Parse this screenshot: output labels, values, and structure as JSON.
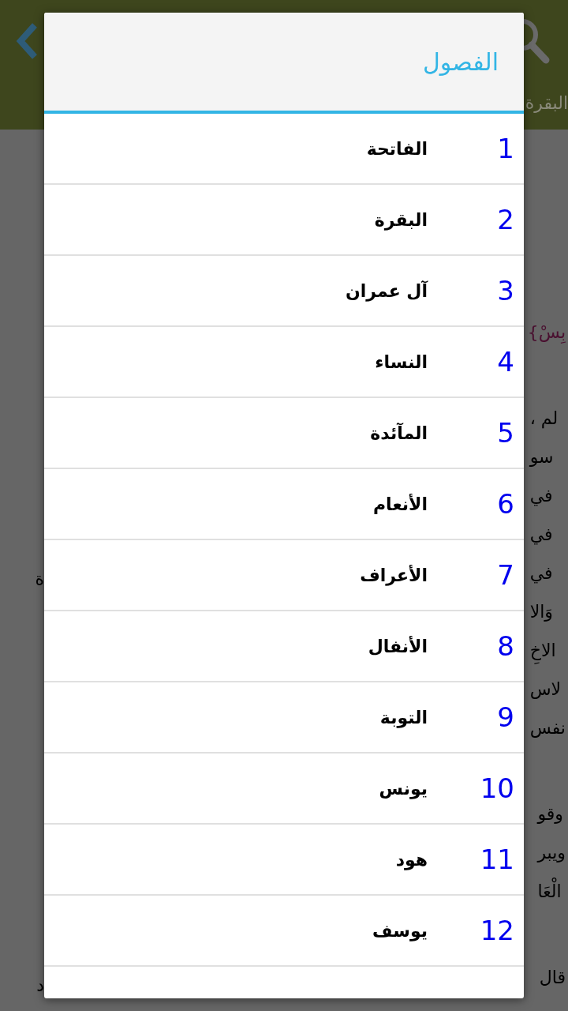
{
  "app_bar": {
    "subtitle": "البقرة"
  },
  "page_text": {
    "right_paragraphs": [
      [
        "{بِسْ"
      ],
      [
        "، لم",
        "سو",
        "في",
        "في",
        "في",
        "وَالا",
        "الاخِ",
        "لاس",
        "نفس"
      ],
      [
        "وقو",
        "ويبر",
        "الْعَا"
      ],
      [
        "قال"
      ]
    ],
    "left_fragments": [
      "ة",
      "د"
    ]
  },
  "dialog": {
    "title": "الفصول",
    "items": [
      {
        "number": "1",
        "name": "الفاتحة"
      },
      {
        "number": "2",
        "name": "البقرة"
      },
      {
        "number": "3",
        "name": "آل عمران"
      },
      {
        "number": "4",
        "name": "النساء"
      },
      {
        "number": "5",
        "name": "المآئدة"
      },
      {
        "number": "6",
        "name": "الأنعام"
      },
      {
        "number": "7",
        "name": "الأعراف"
      },
      {
        "number": "8",
        "name": "الأنفال"
      },
      {
        "number": "9",
        "name": "التوبة"
      },
      {
        "number": "10",
        "name": "يونس"
      },
      {
        "number": "11",
        "name": "هود"
      },
      {
        "number": "12",
        "name": "يوسف"
      }
    ]
  }
}
